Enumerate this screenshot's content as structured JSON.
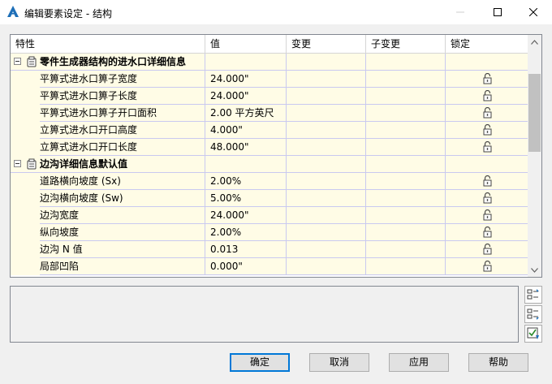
{
  "window": {
    "title": "编辑要素设定 - 结构"
  },
  "grid": {
    "columns": [
      "特性",
      "值",
      "变更",
      "子变更",
      "锁定"
    ],
    "categories": [
      {
        "name": "零件生成器结构的进水口详细信息",
        "rows": [
          {
            "property": "平箅式进水口箅子宽度",
            "value": "24.000\""
          },
          {
            "property": "平箅式进水口箅子长度",
            "value": "24.000\""
          },
          {
            "property": "平箅式进水口箅子开口面积",
            "value": "2.00 平方英尺"
          },
          {
            "property": "立箅式进水口开口高度",
            "value": "4.000\""
          },
          {
            "property": "立箅式进水口开口长度",
            "value": "48.000\""
          }
        ]
      },
      {
        "name": "边沟详细信息默认值",
        "rows": [
          {
            "property": "道路横向坡度 (Sx)",
            "value": "2.00%"
          },
          {
            "property": "边沟横向坡度 (Sw)",
            "value": "5.00%"
          },
          {
            "property": "边沟宽度",
            "value": "24.000\""
          },
          {
            "property": "纵向坡度",
            "value": "2.00%"
          },
          {
            "property": "边沟 N 值",
            "value": "0.013"
          },
          {
            "property": "局部凹陷",
            "value": "0.000\""
          }
        ]
      }
    ]
  },
  "buttons": {
    "ok": "确定",
    "cancel": "取消",
    "apply": "应用",
    "help": "帮助"
  },
  "colors": {
    "row_bg": "#fffce6",
    "grid_line": "#c9c9f0",
    "focus_border": "#0078d7"
  }
}
